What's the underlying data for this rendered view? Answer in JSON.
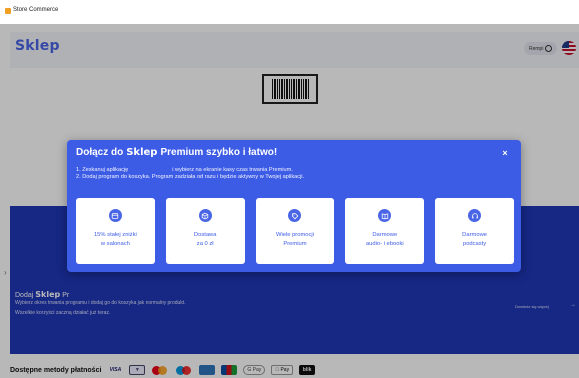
{
  "window": {
    "title": "Store Commerce"
  },
  "header": {
    "logo": "Sklep",
    "login_label": "Rempi",
    "flag_icon": "us-flag-icon"
  },
  "premium_section": {
    "title_prefix": "Dodaj",
    "title_brand": "Sklep",
    "title_suffix": "Pr",
    "desc1": "Wybierz okres trwania programu i dodaj go do koszyka jak normalny produkt.",
    "desc2": "Wszelkie korzyści zaczną działać już teraz.",
    "learn_more": "Dowiedz się więcej",
    "learn_more_arrow": "→"
  },
  "payments": {
    "label": "Dostępne metody płatności",
    "methods": [
      "VISA",
      "bank",
      "mastercard",
      "maestro",
      "amex",
      "jcb",
      "G Pay",
      " Pay",
      "blik"
    ],
    "visa": "VISA",
    "gpay": "G Pay",
    "apay": "Pay",
    "blik": "blik"
  },
  "modal": {
    "title_before": "Dołącz do",
    "title_brand": "Sklep",
    "title_after": "Premium szybko i łatwo!",
    "close": "×",
    "step1_a": "1. Zeskanuj aplikację",
    "step1_b": "i wybierz na ekranie kasy czas trwania Premium.",
    "step2": "2. Dodaj program do koszyka. Program zadziała od razu i będzie aktywny w Twojej aplikacji.",
    "cards": [
      {
        "line1": "15% stałej zniżki",
        "line2": "w salonach",
        "icon": "store-icon"
      },
      {
        "line1": "Dostawa",
        "line2": "za 0 zł",
        "icon": "package-icon"
      },
      {
        "line1": "Wiele promocji",
        "line2": "Premium",
        "icon": "tag-icon"
      },
      {
        "line1": "Darmowe",
        "line2": "audio- i ebooki",
        "icon": "book-icon"
      },
      {
        "line1": "Darmowe",
        "line2": "podcasty",
        "icon": "headphones-icon"
      }
    ]
  },
  "colors": {
    "modal_bg": "#3d5ce6",
    "band_bg": "#1f37b8",
    "brand": "#4b66e6"
  }
}
